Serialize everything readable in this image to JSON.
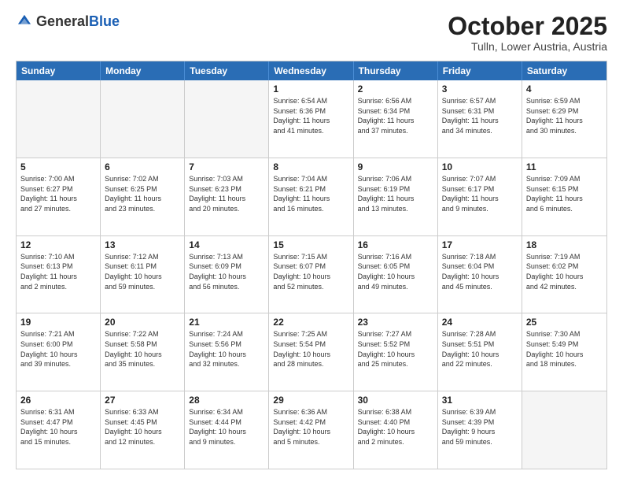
{
  "header": {
    "logo_general": "General",
    "logo_blue": "Blue",
    "title": "October 2025",
    "subtitle": "Tulln, Lower Austria, Austria"
  },
  "weekdays": [
    "Sunday",
    "Monday",
    "Tuesday",
    "Wednesday",
    "Thursday",
    "Friday",
    "Saturday"
  ],
  "rows": [
    [
      {
        "day": "",
        "info": "",
        "empty": true
      },
      {
        "day": "",
        "info": "",
        "empty": true
      },
      {
        "day": "",
        "info": "",
        "empty": true
      },
      {
        "day": "1",
        "info": "Sunrise: 6:54 AM\nSunset: 6:36 PM\nDaylight: 11 hours\nand 41 minutes."
      },
      {
        "day": "2",
        "info": "Sunrise: 6:56 AM\nSunset: 6:34 PM\nDaylight: 11 hours\nand 37 minutes."
      },
      {
        "day": "3",
        "info": "Sunrise: 6:57 AM\nSunset: 6:31 PM\nDaylight: 11 hours\nand 34 minutes."
      },
      {
        "day": "4",
        "info": "Sunrise: 6:59 AM\nSunset: 6:29 PM\nDaylight: 11 hours\nand 30 minutes."
      }
    ],
    [
      {
        "day": "5",
        "info": "Sunrise: 7:00 AM\nSunset: 6:27 PM\nDaylight: 11 hours\nand 27 minutes."
      },
      {
        "day": "6",
        "info": "Sunrise: 7:02 AM\nSunset: 6:25 PM\nDaylight: 11 hours\nand 23 minutes."
      },
      {
        "day": "7",
        "info": "Sunrise: 7:03 AM\nSunset: 6:23 PM\nDaylight: 11 hours\nand 20 minutes."
      },
      {
        "day": "8",
        "info": "Sunrise: 7:04 AM\nSunset: 6:21 PM\nDaylight: 11 hours\nand 16 minutes."
      },
      {
        "day": "9",
        "info": "Sunrise: 7:06 AM\nSunset: 6:19 PM\nDaylight: 11 hours\nand 13 minutes."
      },
      {
        "day": "10",
        "info": "Sunrise: 7:07 AM\nSunset: 6:17 PM\nDaylight: 11 hours\nand 9 minutes."
      },
      {
        "day": "11",
        "info": "Sunrise: 7:09 AM\nSunset: 6:15 PM\nDaylight: 11 hours\nand 6 minutes."
      }
    ],
    [
      {
        "day": "12",
        "info": "Sunrise: 7:10 AM\nSunset: 6:13 PM\nDaylight: 11 hours\nand 2 minutes."
      },
      {
        "day": "13",
        "info": "Sunrise: 7:12 AM\nSunset: 6:11 PM\nDaylight: 10 hours\nand 59 minutes."
      },
      {
        "day": "14",
        "info": "Sunrise: 7:13 AM\nSunset: 6:09 PM\nDaylight: 10 hours\nand 56 minutes."
      },
      {
        "day": "15",
        "info": "Sunrise: 7:15 AM\nSunset: 6:07 PM\nDaylight: 10 hours\nand 52 minutes."
      },
      {
        "day": "16",
        "info": "Sunrise: 7:16 AM\nSunset: 6:05 PM\nDaylight: 10 hours\nand 49 minutes."
      },
      {
        "day": "17",
        "info": "Sunrise: 7:18 AM\nSunset: 6:04 PM\nDaylight: 10 hours\nand 45 minutes."
      },
      {
        "day": "18",
        "info": "Sunrise: 7:19 AM\nSunset: 6:02 PM\nDaylight: 10 hours\nand 42 minutes."
      }
    ],
    [
      {
        "day": "19",
        "info": "Sunrise: 7:21 AM\nSunset: 6:00 PM\nDaylight: 10 hours\nand 39 minutes."
      },
      {
        "day": "20",
        "info": "Sunrise: 7:22 AM\nSunset: 5:58 PM\nDaylight: 10 hours\nand 35 minutes."
      },
      {
        "day": "21",
        "info": "Sunrise: 7:24 AM\nSunset: 5:56 PM\nDaylight: 10 hours\nand 32 minutes."
      },
      {
        "day": "22",
        "info": "Sunrise: 7:25 AM\nSunset: 5:54 PM\nDaylight: 10 hours\nand 28 minutes."
      },
      {
        "day": "23",
        "info": "Sunrise: 7:27 AM\nSunset: 5:52 PM\nDaylight: 10 hours\nand 25 minutes."
      },
      {
        "day": "24",
        "info": "Sunrise: 7:28 AM\nSunset: 5:51 PM\nDaylight: 10 hours\nand 22 minutes."
      },
      {
        "day": "25",
        "info": "Sunrise: 7:30 AM\nSunset: 5:49 PM\nDaylight: 10 hours\nand 18 minutes."
      }
    ],
    [
      {
        "day": "26",
        "info": "Sunrise: 6:31 AM\nSunset: 4:47 PM\nDaylight: 10 hours\nand 15 minutes."
      },
      {
        "day": "27",
        "info": "Sunrise: 6:33 AM\nSunset: 4:45 PM\nDaylight: 10 hours\nand 12 minutes."
      },
      {
        "day": "28",
        "info": "Sunrise: 6:34 AM\nSunset: 4:44 PM\nDaylight: 10 hours\nand 9 minutes."
      },
      {
        "day": "29",
        "info": "Sunrise: 6:36 AM\nSunset: 4:42 PM\nDaylight: 10 hours\nand 5 minutes."
      },
      {
        "day": "30",
        "info": "Sunrise: 6:38 AM\nSunset: 4:40 PM\nDaylight: 10 hours\nand 2 minutes."
      },
      {
        "day": "31",
        "info": "Sunrise: 6:39 AM\nSunset: 4:39 PM\nDaylight: 9 hours\nand 59 minutes."
      },
      {
        "day": "",
        "info": "",
        "empty": true
      }
    ]
  ]
}
